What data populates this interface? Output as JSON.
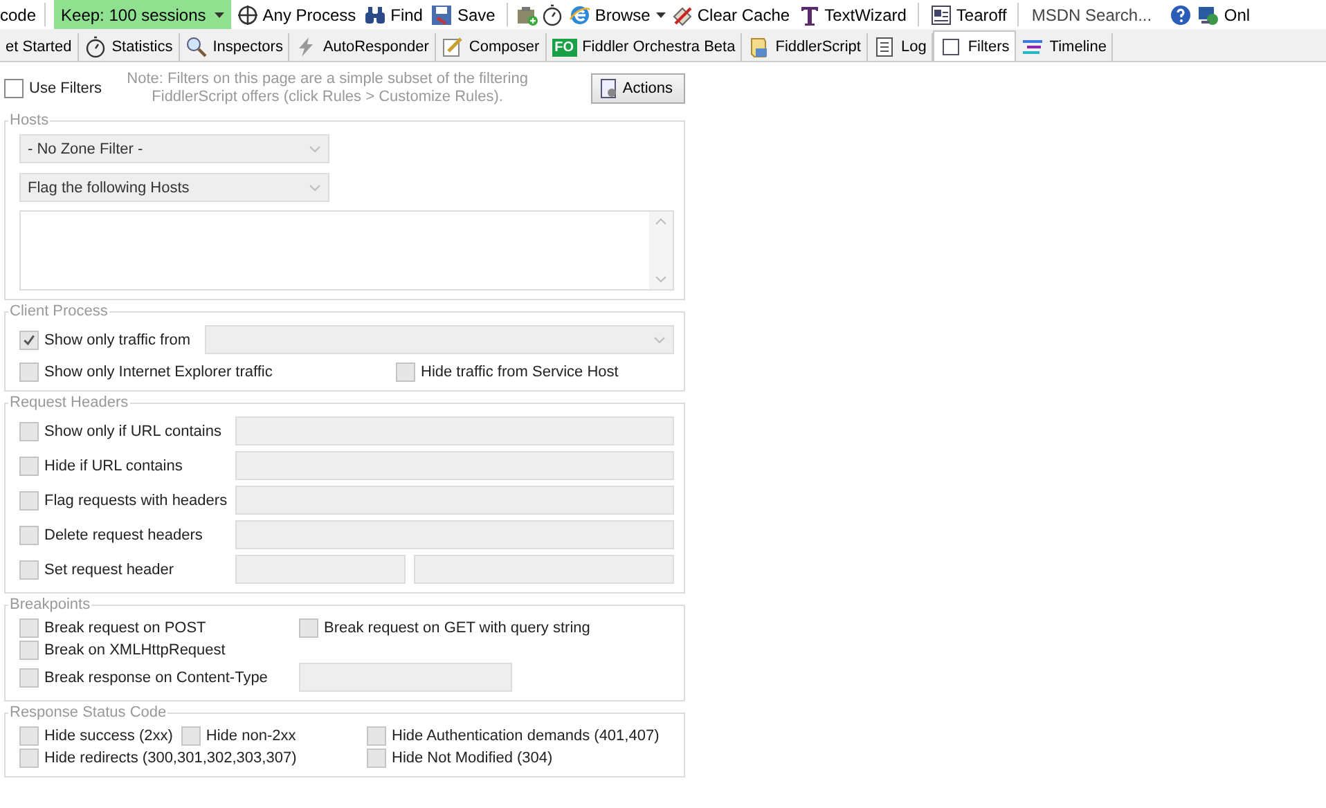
{
  "toolbar": {
    "items": [
      {
        "kind": "text",
        "label": "code"
      },
      {
        "kind": "separator"
      },
      {
        "kind": "dropdown",
        "label": "Keep: 100 sessions"
      },
      {
        "kind": "button",
        "label": "Any Process"
      },
      {
        "kind": "button",
        "label": "Find"
      },
      {
        "kind": "button",
        "label": "Save"
      },
      {
        "kind": "separator"
      },
      {
        "kind": "icon"
      },
      {
        "kind": "icon"
      },
      {
        "kind": "button",
        "label": "Browse"
      },
      {
        "kind": "menu"
      },
      {
        "kind": "button",
        "label": "Clear Cache"
      },
      {
        "kind": "button",
        "label": "TextWizard"
      },
      {
        "kind": "separator"
      },
      {
        "kind": "button",
        "label": "Tearoff"
      },
      {
        "kind": "separator"
      },
      {
        "kind": "search",
        "placeholder": "MSDN Search..."
      },
      {
        "kind": "icon"
      },
      {
        "kind": "button",
        "label": "Onl"
      }
    ]
  },
  "tabs": [
    {
      "label": "et Started",
      "selected": false
    },
    {
      "label": "Statistics",
      "selected": false
    },
    {
      "label": "Inspectors",
      "selected": false
    },
    {
      "label": "AutoResponder",
      "selected": false
    },
    {
      "label": "Composer",
      "selected": false
    },
    {
      "label": "Fiddler Orchestra Beta",
      "badge": "FO",
      "selected": false
    },
    {
      "label": "FiddlerScript",
      "selected": false
    },
    {
      "label": "Log",
      "selected": false
    },
    {
      "label": "Filters",
      "selected": true
    },
    {
      "label": "Timeline",
      "selected": false
    }
  ],
  "filters": {
    "use_filters": {
      "label": "Use Filters",
      "checked": false,
      "disabled": false
    },
    "note": "Note: Filters on this page are a simple subset of the filtering FiddlerScript offers (click Rules > Customize Rules).",
    "actions_button": "Actions",
    "hosts": {
      "title": "Hosts",
      "zone_select": "- No Zone Filter -",
      "action_select": "Flag the following Hosts"
    },
    "client_process": {
      "title": "Client Process",
      "show_only_from": {
        "label": "Show only traffic from",
        "checked": true,
        "disabled": true
      },
      "ie_only": {
        "label": "Show only Internet Explorer traffic",
        "checked": false,
        "disabled": true
      },
      "hide_service_host": {
        "label": "Hide traffic from Service Host",
        "checked": false,
        "disabled": true
      }
    },
    "request_headers": {
      "title": "Request Headers",
      "rows": [
        {
          "kind": "single",
          "label": "Show only if URL contains",
          "checked": false,
          "disabled": true
        },
        {
          "kind": "single",
          "label": "Hide if URL contains",
          "checked": false,
          "disabled": true
        },
        {
          "kind": "single",
          "label": "Flag requests with headers",
          "checked": false,
          "disabled": true
        },
        {
          "kind": "single",
          "label": "Delete request headers",
          "checked": false,
          "disabled": true
        },
        {
          "kind": "pair",
          "label": "Set request header",
          "checked": false,
          "disabled": true
        }
      ]
    },
    "breakpoints": {
      "title": "Breakpoints",
      "rows": [
        [
          {
            "kind": "checkbox",
            "label": "Break request on POST",
            "checked": false,
            "disabled": true
          },
          {
            "kind": "checkbox",
            "label": "Break request on GET with query string",
            "checked": false,
            "disabled": true
          }
        ],
        [
          {
            "kind": "checkbox",
            "label": "Break on XMLHttpRequest",
            "checked": false,
            "disabled": true
          }
        ],
        [
          {
            "kind": "checkbox",
            "label": "Break response on Content-Type",
            "checked": false,
            "disabled": true
          },
          {
            "kind": "field"
          }
        ]
      ]
    },
    "status_codes": {
      "title": "Response Status Code",
      "rows": [
        {
          "left": [
            {
              "label": "Hide success (2xx)",
              "checked": false,
              "disabled": true
            },
            {
              "label": "Hide non-2xx",
              "checked": false,
              "disabled": true
            }
          ],
          "right": {
            "label": "Hide Authentication demands (401,407)",
            "checked": false,
            "disabled": true
          }
        },
        {
          "left": [
            {
              "label": "Hide redirects (300,301,302,303,307)",
              "checked": false,
              "disabled": true
            }
          ],
          "right": {
            "label": "Hide Not Modified (304)",
            "checked": false,
            "disabled": true
          }
        }
      ]
    }
  }
}
